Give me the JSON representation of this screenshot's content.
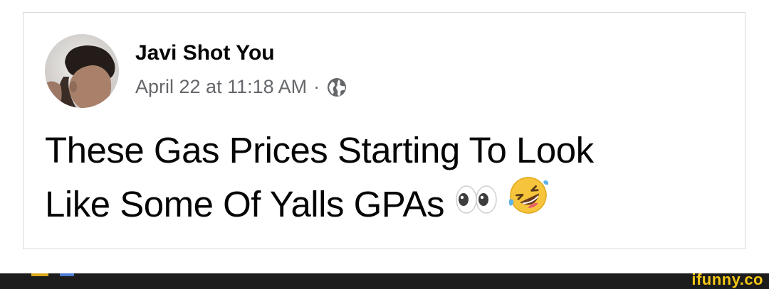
{
  "post": {
    "author_name": "Javi Shot You",
    "timestamp": "April 22 at 11:18 AM",
    "separator": "·",
    "privacy_icon": "globe-icon",
    "text_line1": "These Gas Prices Starting To Look",
    "text_line2": "Like Some Of Yalls GPAs",
    "emojis": [
      "eyes-emoji",
      "rolling-on-floor-laughing-emoji"
    ]
  },
  "watermark": {
    "text": "ifunny.co"
  },
  "colors": {
    "name": "#050505",
    "meta": "#65676b",
    "border": "#d8dadf",
    "watermark": "#f3c613",
    "bar": "#1c1c1c"
  }
}
